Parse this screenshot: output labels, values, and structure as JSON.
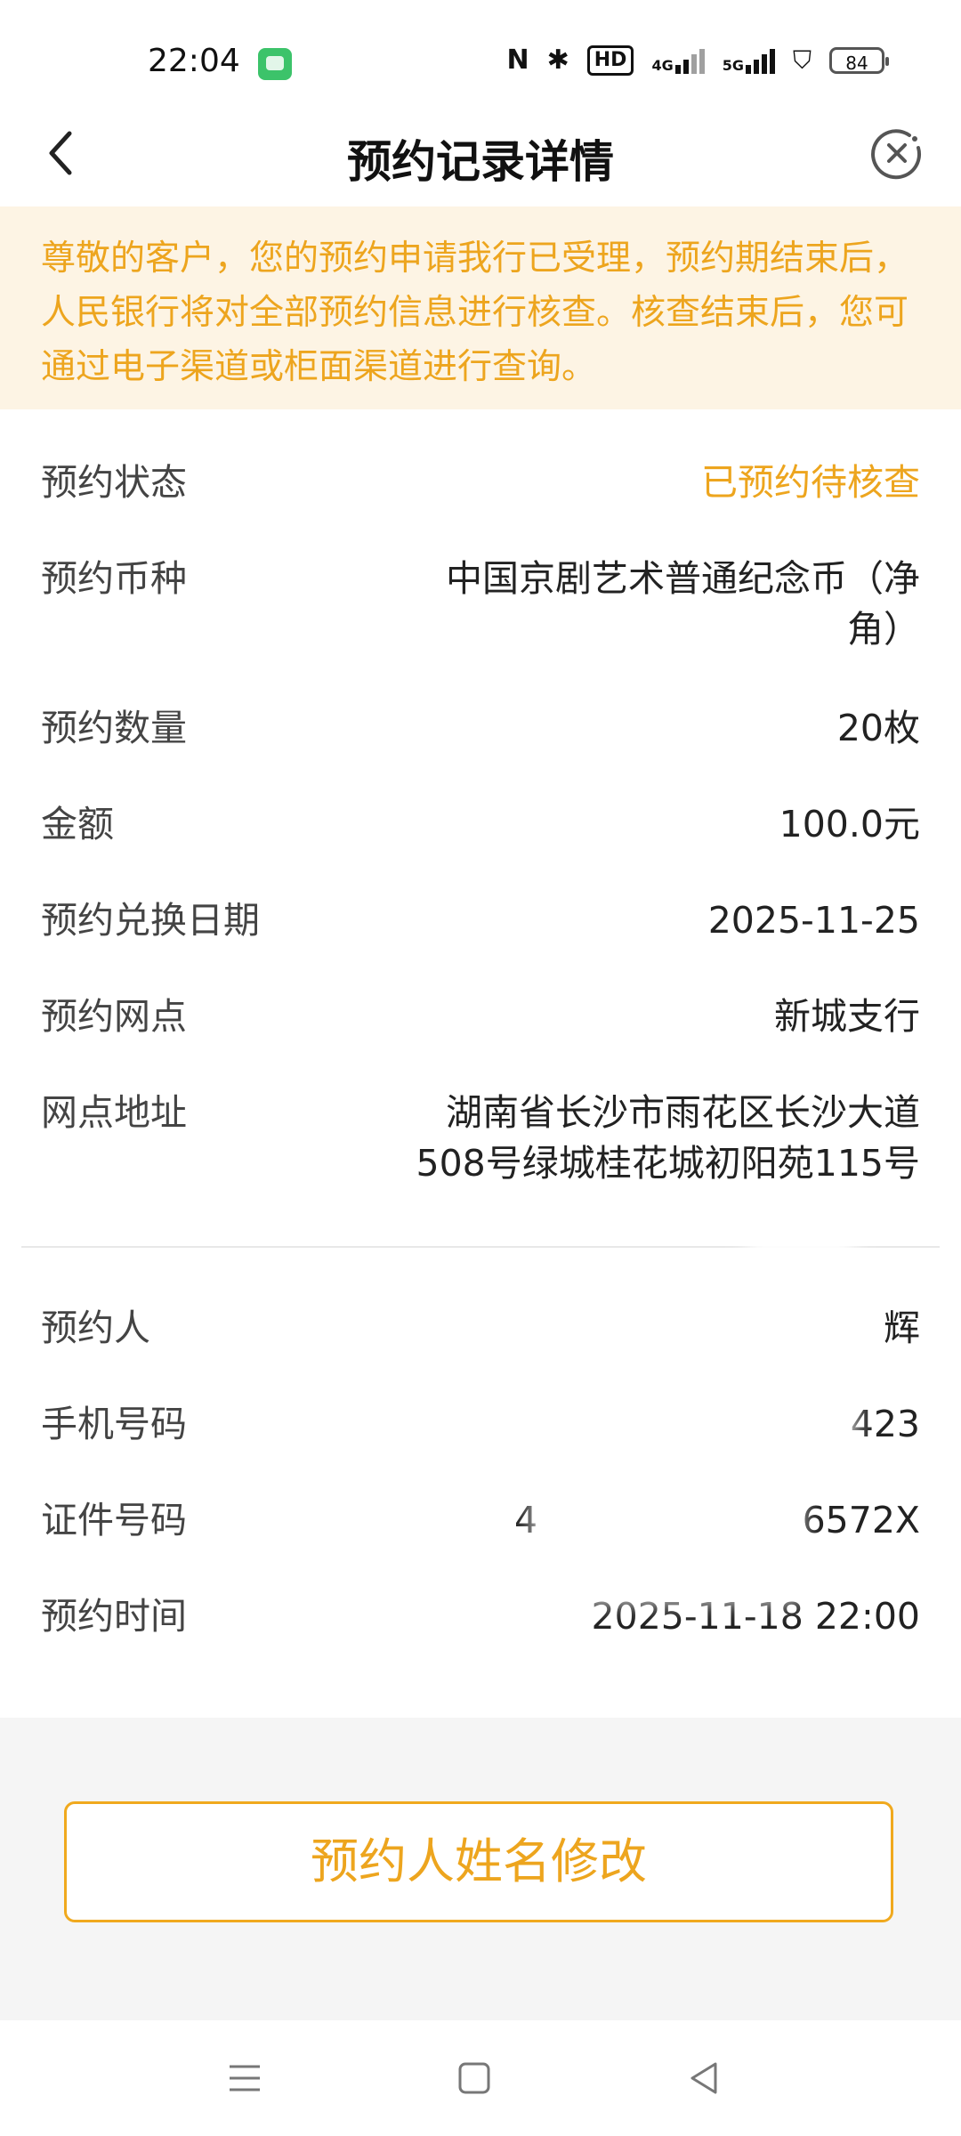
{
  "status_bar": {
    "time": "22:04",
    "network_4g": "4G",
    "network_5g": "5G",
    "hd_badge": "HD",
    "battery": "84"
  },
  "header": {
    "title": "预约记录详情",
    "back_icon": "chevron-left-icon",
    "close_icon": "close-circle-icon"
  },
  "notice": {
    "text": "尊敬的客户，您的预约申请我行已受理，预约期结束后，人民银行将对全部预约信息进行核查。核查结束后，您可通过电子渠道或柜面渠道进行查询。"
  },
  "details": [
    {
      "label": "预约状态",
      "value": "已预约待核查"
    },
    {
      "label": "预约币种",
      "value": "中国京剧艺术普通纪念币（净角）"
    },
    {
      "label": "预约数量",
      "value": "20枚"
    },
    {
      "label": "金额",
      "value": "100.0元"
    },
    {
      "label": "预约兑换日期",
      "value": "2025-11-25"
    },
    {
      "label": "预约网点",
      "value": "新城支行"
    },
    {
      "label": "网点地址",
      "value": "湖南省长沙市雨花区长沙大道508号绿城桂花城初阳苑115号"
    }
  ],
  "person": [
    {
      "label": "预约人",
      "value": "辉"
    },
    {
      "label": "手机号码",
      "value": "423"
    },
    {
      "label": "证件号码",
      "value_start": "4",
      "value_end": "6572X"
    },
    {
      "label": "预约时间",
      "value": "2025-11-18 22:00"
    }
  ],
  "actions": {
    "modify_name_label": "预约人姓名修改"
  },
  "colors": {
    "accent": "#eda51e",
    "notice_bg": "#fdf4e4",
    "bottom_bg": "#f5f5f5"
  }
}
